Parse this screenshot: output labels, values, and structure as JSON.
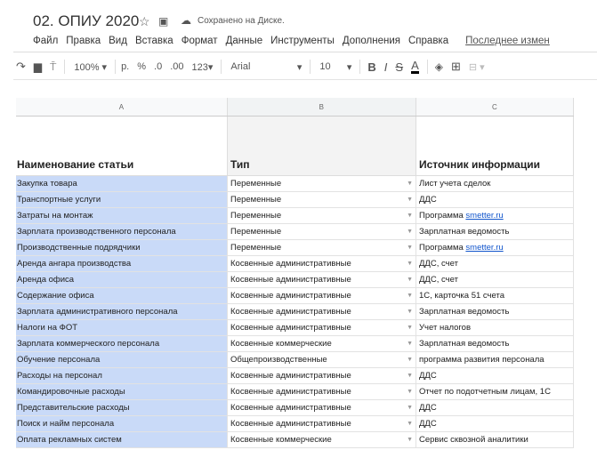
{
  "doc": {
    "title": "02. ОПИУ 2020",
    "status": "Сохранено на Диске."
  },
  "menu": [
    "Файл",
    "Правка",
    "Вид",
    "Вставка",
    "Формат",
    "Данные",
    "Инструменты",
    "Дополнения",
    "Справка"
  ],
  "last_edit": "Последнее измен",
  "toolbar": {
    "zoom": "100%",
    "currency": "р.",
    "percent": "%",
    "dec_less": ".0",
    "dec_more": ".00",
    "format": "123",
    "font": "Arial",
    "size": "10",
    "bold": "B",
    "italic": "I",
    "strike": "S",
    "color": "A"
  },
  "columns": [
    "A",
    "B",
    "C"
  ],
  "headers": [
    "Наименование статьи",
    "Тип",
    "Источник информации"
  ],
  "rows": [
    [
      "Закупка товара",
      "Переменные",
      "Лист учета сделок",
      ""
    ],
    [
      "Транспортные услуги",
      "Переменные",
      "ДДС",
      ""
    ],
    [
      "Затраты на монтаж",
      "Переменные",
      "Программа ",
      "smetter.ru"
    ],
    [
      "Зарплата производственного персонала",
      "Переменные",
      "Зарплатная ведомость",
      ""
    ],
    [
      "Производственные подрядчики",
      "Переменные",
      "Программа ",
      "smetter.ru"
    ],
    [
      "Аренда ангара производства",
      "Косвенные административные",
      "ДДС, счет",
      ""
    ],
    [
      "Аренда офиса",
      "Косвенные административные",
      "ДДС, счет",
      ""
    ],
    [
      "Содержание офиса",
      "Косвенные административные",
      "1С, карточка 51 счета",
      ""
    ],
    [
      "Зарплата административного персонала",
      "Косвенные административные",
      "Зарплатная ведомость",
      ""
    ],
    [
      "Налоги на ФОТ",
      "Косвенные административные",
      "Учет налогов",
      ""
    ],
    [
      "Зарплата коммерческого персонала",
      "Косвенные коммерческие",
      "Зарплатная ведомость",
      ""
    ],
    [
      "Обучение персонала",
      "Общепроизводственные",
      "программа развития персонала",
      ""
    ],
    [
      "Расходы на персонал",
      "Косвенные административные",
      "ДДС",
      ""
    ],
    [
      "Командировочные расходы",
      "Косвенные административные",
      "Отчет по подотчетным лицам, 1С",
      ""
    ],
    [
      "Представительские расходы",
      "Косвенные административные",
      "ДДС",
      ""
    ],
    [
      "Поиск и найм персонала",
      "Косвенные административные",
      "ДДС",
      ""
    ],
    [
      "Оплата рекламных систем",
      "Косвенные коммерческие",
      "Сервис сквозной аналитики",
      ""
    ]
  ]
}
